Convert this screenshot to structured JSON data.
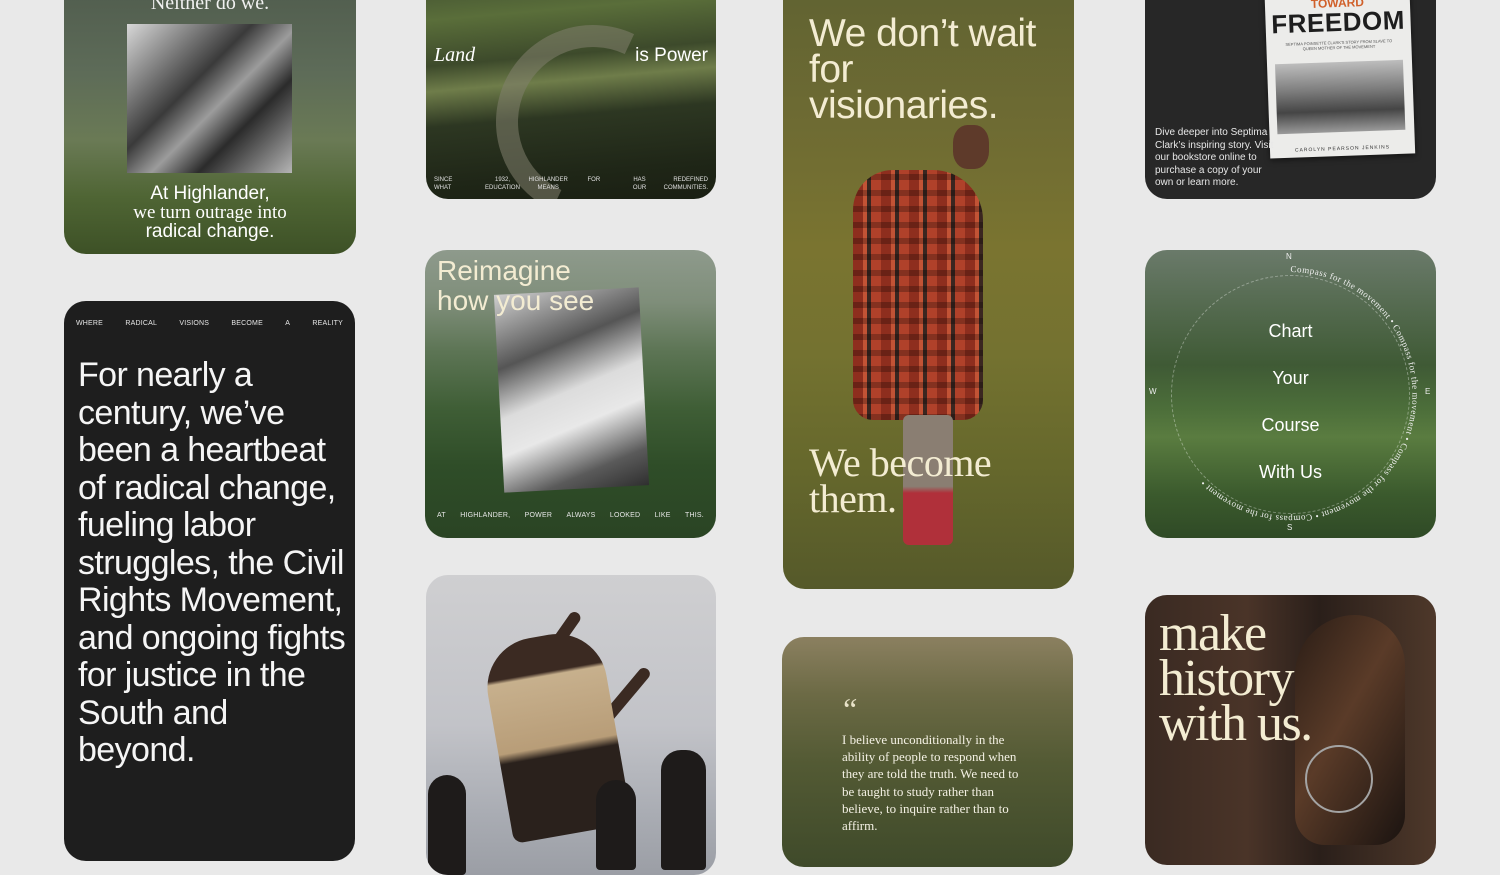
{
  "card1": {
    "top_text": "Neither do we.",
    "caption_line1": "At Highlander,",
    "caption_line2": "we turn outrage into",
    "caption_line3": "radical change."
  },
  "card2": {
    "left_label": "Land",
    "right_label": "is Power",
    "ticker": [
      [
        "SINCE",
        "WHAT"
      ],
      [
        "1932,",
        "EDUCATION"
      ],
      [
        "HIGHLANDER",
        "MEANS"
      ],
      [
        "FOR",
        ""
      ],
      [
        "HAS",
        "OUR"
      ],
      [
        "REDEFINED",
        "COMMUNITIES."
      ]
    ]
  },
  "card3": {
    "headline": "We don’t wait for visionaries.",
    "subhead": "We become them."
  },
  "card4": {
    "book_kicker": "TOWARD",
    "book_title": "FREEDOM",
    "book_subtitle": "SEPTIMA POINSETTE CLARK'S STORY FROM SLAVE TO QUEEN MOTHER OF THE MOVEMENT",
    "book_author": "CAROLYN PEARSON JENKINS",
    "blurb": "Dive deeper into Septima Clark’s inspiring story. Visit our bookstore online to purchase a copy of your own or learn more."
  },
  "card5": {
    "ticker": [
      "WHERE",
      "RADICAL",
      "VISIONS",
      "BECOME",
      "A",
      "REALITY"
    ],
    "body": "For nearly a century, we’ve been a heartbeat of radical change, fueling labor struggles, the Civil Rights Movement, and ongoing fights for justice in the South and beyond."
  },
  "card6": {
    "headline_line1": "Reimagine",
    "headline_line2": "how you see",
    "ticker": [
      "AT",
      "HIGHLANDER,",
      "POWER",
      "ALWAYS",
      "LOOKED",
      "LIKE",
      "THIS."
    ]
  },
  "card7": {
    "n": "N",
    "s": "S",
    "e": "E",
    "w": "W",
    "ring_text": "Compass for the movement",
    "lines": [
      "Chart",
      "Your",
      "Course",
      "With Us"
    ]
  },
  "card9": {
    "quote_mark": "“",
    "quote": "I believe unconditionally in the ability of people to respond when they are told the truth. We need to be taught to study rather than believe, to inquire rather than to affirm."
  },
  "card10": {
    "headline": "make history with us."
  },
  "colors": {
    "background": "#e9e9e9",
    "dark_card": "#1e1e1e",
    "cream_text": "#f3ecd2"
  }
}
